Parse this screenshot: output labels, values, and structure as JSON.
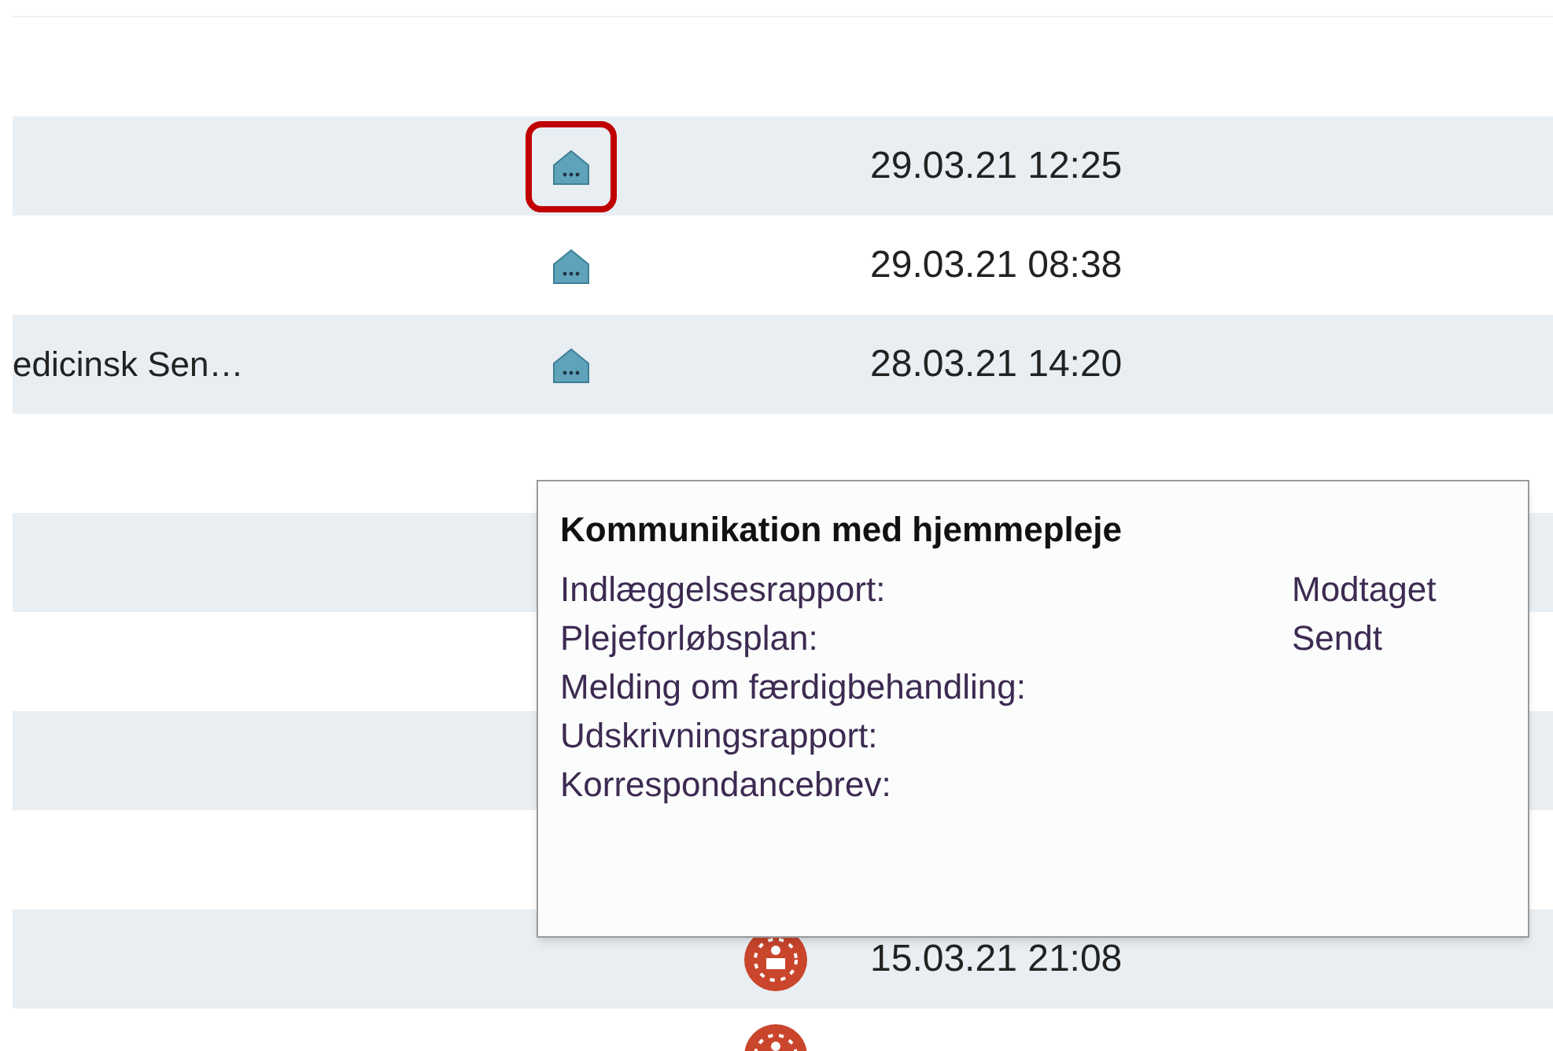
{
  "rows": [
    {
      "kind": "house",
      "date": "29.03.21 12:25",
      "highlighted": true
    },
    {
      "kind": "house",
      "date": "29.03.21 08:38",
      "highlighted": false
    },
    {
      "name": "edicinsk Sen…",
      "kind": "house",
      "date": "28.03.21 14:20",
      "highlighted": false
    },
    {
      "highlighted": false
    },
    {
      "highlighted": false
    },
    {
      "highlighted": false
    },
    {
      "highlighted": false
    },
    {
      "highlighted": false
    },
    {
      "kind": "care",
      "date": "15.03.21 21:08",
      "highlighted": false
    },
    {
      "kind": "care",
      "highlighted": false
    }
  ],
  "tooltip": {
    "title": "Kommunikation med hjemmepleje",
    "items": [
      {
        "label": "Indlæggelsesrapport:",
        "value": "Modtaget"
      },
      {
        "label": "Plejeforløbsplan:",
        "value": "Sendt"
      },
      {
        "label": "Melding om færdigbehandling:"
      },
      {
        "label": "Udskrivningsrapport:"
      },
      {
        "label": "Korrespondancebrev:"
      }
    ]
  }
}
